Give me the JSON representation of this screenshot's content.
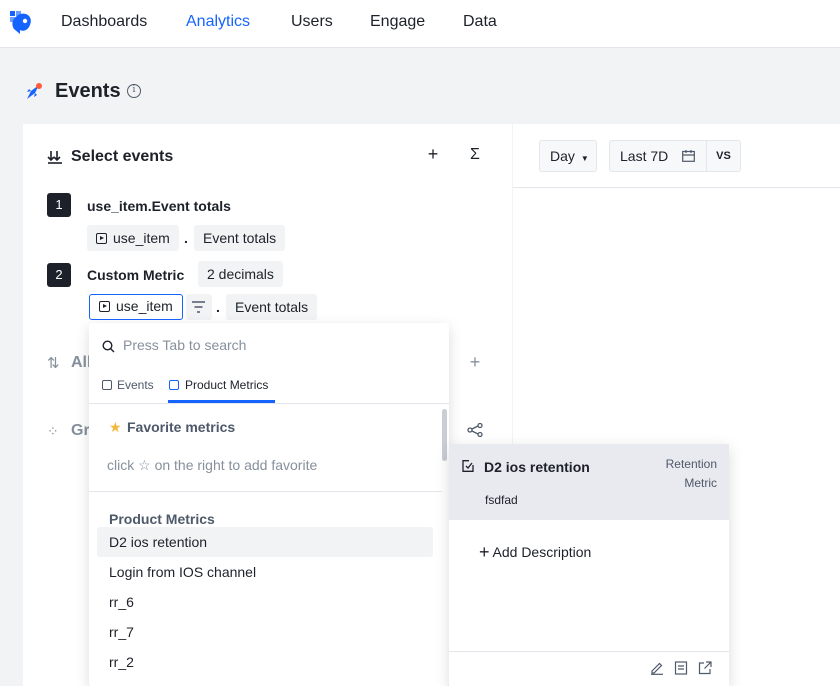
{
  "nav": {
    "items": [
      "Dashboards",
      "Analytics",
      "Users",
      "Engage",
      "Data"
    ],
    "active": "Analytics"
  },
  "page": {
    "title": "Events"
  },
  "select_events": {
    "heading": "Select events",
    "add_icon": "plus-icon",
    "formula_icon": "sigma-icon",
    "events": [
      {
        "index": "1",
        "title": "use_item.Event totals",
        "event": "use_item",
        "measure": "Event totals"
      },
      {
        "index": "2",
        "title": "Custom Metric",
        "decimals": "2 decimals",
        "event": "use_item",
        "measure": "Event totals"
      }
    ],
    "separator": "."
  },
  "hidden_rows": {
    "row1": "All",
    "row2": "Gr"
  },
  "toolbar": {
    "granularity": "Day",
    "date_range": "Last 7D",
    "compare": "VS"
  },
  "dropdown": {
    "search_placeholder": "Press Tab to search",
    "tabs": [
      "Events",
      "Product Metrics"
    ],
    "active_tab": "Product Metrics",
    "favorites_heading": "Favorite metrics",
    "favorites_hint_pre": "click",
    "favorites_hint_post": "on the right to add favorite",
    "group_heading": "Product Metrics",
    "items": [
      "D2 ios retention",
      "Login from IOS channel",
      "rr_6",
      "rr_7",
      "rr_2"
    ]
  },
  "detail": {
    "title": "D2 ios retention",
    "type_line1": "Retention",
    "type_line2": "Metric",
    "description": "fsdfad",
    "add_description": "Add Description"
  },
  "colors": {
    "accent": "#1664ff",
    "text": "#1d2129",
    "muted": "#86909c"
  }
}
